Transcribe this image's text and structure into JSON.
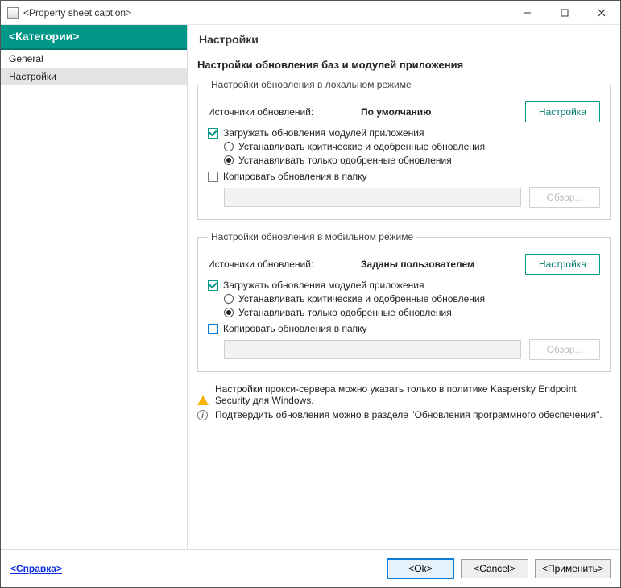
{
  "window": {
    "title": "<Property sheet caption>"
  },
  "sidebar": {
    "header": "<Категории>",
    "items": [
      {
        "label": "General"
      },
      {
        "label": "Настройки"
      }
    ]
  },
  "main": {
    "header": "Настройки",
    "section_title": "Настройки обновления баз и модулей приложения",
    "local": {
      "legend": "Настройки обновления в локальном режиме",
      "sources_label": "Источники обновлений:",
      "sources_value": "По умолчанию",
      "config_button": "Настройка",
      "download_modules": "Загружать обновления модулей приложения",
      "radio_critical_approved": "Устанавливать критические и одобренные обновления",
      "radio_approved_only": "Устанавливать только одобренные обновления",
      "copy_to_folder": "Копировать обновления в папку",
      "browse": "Обзор..."
    },
    "mobile": {
      "legend": "Настройки обновления в мобильном режиме",
      "sources_label": "Источники обновлений:",
      "sources_value": "Заданы пользователем",
      "config_button": "Настройка",
      "download_modules": "Загружать обновления модулей приложения",
      "radio_critical_approved": "Устанавливать критические и одобренные обновления",
      "radio_approved_only": "Устанавливать только одобренные обновления",
      "copy_to_folder": "Копировать обновления в папку",
      "browse": "Обзор..."
    },
    "notes": {
      "proxy": "Настройки прокси-сервера можно указать только в политике Kaspersky Endpoint Security для Windows.",
      "confirm": "Подтвердить обновления можно в разделе \"Обновления программного обеспечения\"."
    }
  },
  "footer": {
    "help": "<Справка>",
    "ok": "<Ok>",
    "cancel": "<Cancel>",
    "apply": "<Применить>"
  }
}
